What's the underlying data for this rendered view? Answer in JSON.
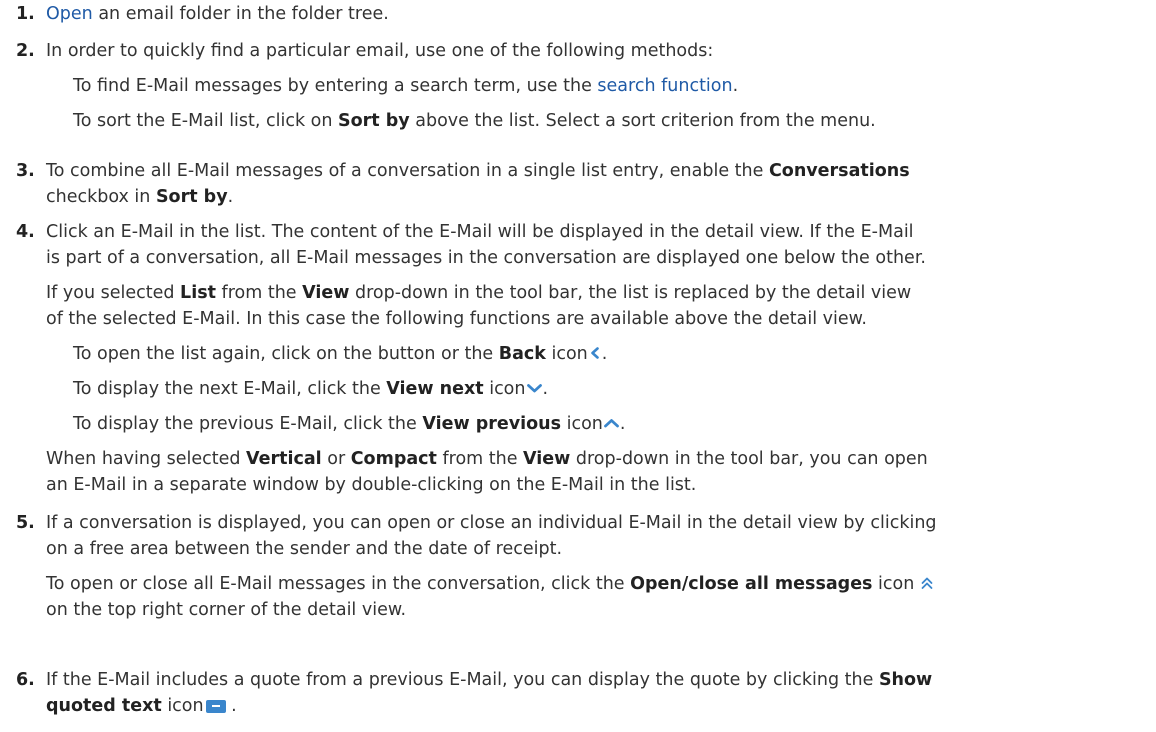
{
  "steps": [
    {
      "num": "1.",
      "pre": "",
      "link": "Open",
      "post": " an email folder in the folder tree."
    },
    {
      "num": "2.",
      "text": "In order to quickly find a particular email, use one of the following methods:",
      "sub1_pre": "To find E-Mail messages by entering a search term, use the ",
      "sub1_link": "search function",
      "sub1_post": ".",
      "sub2_pre": "To sort the E-Mail list, click on ",
      "sub2_bold": "Sort by",
      "sub2_post": " above the list. Select a sort criterion from the menu."
    },
    {
      "num": "3.",
      "l1_pre": "To combine all E-Mail messages of a conversation in a single list entry, enable the ",
      "l1_bold": "Conversations",
      "l2_bold_pre": "",
      "l2_pre": "checkbox in ",
      "l2_bold": "Sort by",
      "l2_post": "."
    },
    {
      "num": "4.",
      "l1": "Click an E-Mail in the list. The content of the E-Mail will be displayed in the detail view. If the E-Mail",
      "l2": "is part of a conversation, all E-Mail messages in the conversation are displayed one below the other.",
      "l3_a": "If you selected ",
      "l3_b": "List",
      "l3_c": " from the ",
      "l3_d": "View",
      "l3_e": " drop-down in the tool bar, the list is replaced by the detail view",
      "l4": "of the selected E-Mail. In this case the following functions are available above the detail view.",
      "s1_a": "To open the list again, click on the button or the ",
      "s1_b": "Back",
      "s1_c": " icon",
      "s1_d": ".",
      "s2_a": "To display the next E-Mail, click the ",
      "s2_b": "View next",
      "s2_c": " icon",
      "s2_d": ".",
      "s3_a": "To display the previous E-Mail, click the ",
      "s3_b": "View previous",
      "s3_c": " icon",
      "s3_d": ".",
      "l5_a": "When having selected ",
      "l5_b": "Vertical",
      "l5_c": " or ",
      "l5_d": "Compact",
      "l5_e": " from the ",
      "l5_f": "View",
      "l5_g": " drop-down in the tool bar, you can open",
      "l6": "an E-Mail in a separate window by double-clicking on the E-Mail in the list."
    },
    {
      "num": "5.",
      "l1": "If a conversation is displayed, you can open or close an individual E-Mail in the detail view by clicking",
      "l2": "on a free area between the sender and the date of receipt.",
      "l3_a": "To open or close all E-Mail messages in the conversation, click the ",
      "l3_b": "Open/close all messages",
      "l3_c": " icon",
      "l4": "on the top right corner of the detail view."
    },
    {
      "num": "6.",
      "l1_a": "If the E-Mail includes a quote from a previous E-Mail, you can display the quote by clicking the ",
      "l1_b": "Show",
      "l2_b": "quoted text",
      "l2_c": " icon",
      "l2_d": " ."
    }
  ],
  "icons": {
    "back": "chevron-left-icon",
    "next": "chevron-down-icon",
    "previous": "chevron-up-icon",
    "open_close_all": "double-chevron-up-icon",
    "quoted_text": "quoted-text-icon",
    "accent_color": "#3a86cc",
    "link_color": "#1f5aa6"
  }
}
